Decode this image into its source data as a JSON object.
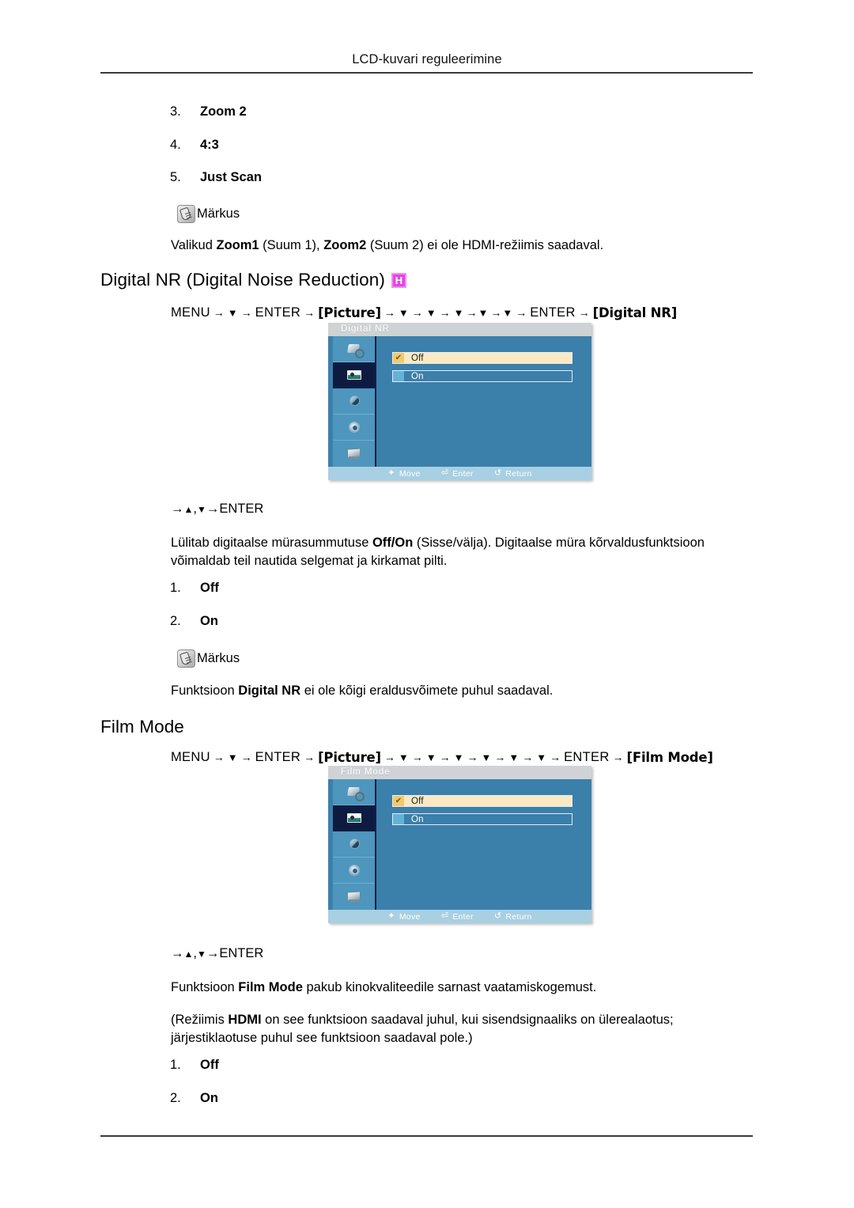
{
  "header": {
    "running_head": "LCD-kuvari reguleerimine"
  },
  "list_top": [
    {
      "num": "3.",
      "text": "Zoom 2"
    },
    {
      "num": "4.",
      "text": "4:3"
    },
    {
      "num": "5.",
      "text": "Just Scan"
    }
  ],
  "note_top": {
    "icon": "note-pen-icon",
    "label": "Märkus",
    "body_prefix": "Valikud ",
    "body_b1": "Zoom1",
    "body_mid1": " (Suum 1), ",
    "body_b2": "Zoom2",
    "body_mid2": " (Suum 2) ei ole HDMI-režiimis saadaval."
  },
  "section_digital_nr": {
    "heading": "Digital NR (Digital Noise Reduction)",
    "badge": "H",
    "badge_color": "#e048e0",
    "menu_path": {
      "start": "MENU",
      "arrow": "→",
      "down": "▼",
      "enter": "ENTER",
      "chip_picture": "[Picture]",
      "chip_target": "[Digital NR]",
      "down_count": 5
    },
    "osd": {
      "title": "Digital  NR",
      "sidebar_icons": [
        "input-icon",
        "picture-icon",
        "sound-icon",
        "setup-icon",
        "multi-control-icon"
      ],
      "selected_sidebar_index": 1,
      "rows": [
        {
          "label": "Off",
          "selected": true,
          "check": "✔"
        },
        {
          "label": "On",
          "selected": false,
          "check": ""
        }
      ],
      "footer": [
        {
          "glyph": "✦",
          "label": "Move",
          "icon": "move-icon"
        },
        {
          "glyph": "⏎",
          "label": "Enter",
          "icon": "enter-icon"
        },
        {
          "glyph": "↺",
          "label": "Return",
          "icon": "return-icon"
        }
      ]
    },
    "enter_line": {
      "arrow": "→",
      "up": "▲",
      "comma": ",",
      "down": "▼",
      "enter": "ENTER"
    },
    "description": "Lülitab digitaalse mürasummutuse Off/On (Sisse/välja). Digitaalse müra kõrvaldusfunktsioon võimaldab teil nautida selgemat ja kirkamat pilti.",
    "description_parts": {
      "p1": "Lülitab digitaalse mürasummutuse ",
      "b1": "Off/On",
      "p2": " (Sisse/välja). Digitaalse müra kõrvaldusfunktsioon võimaldab teil nautida selgemat ja kirkamat pilti."
    },
    "options": [
      {
        "num": "1.",
        "text": "Off"
      },
      {
        "num": "2.",
        "text": "On"
      }
    ],
    "note": {
      "icon": "note-pen-icon",
      "label": "Märkus",
      "body_p1": "Funktsioon ",
      "body_b1": "Digital NR",
      "body_p2": " ei ole kõigi eraldusvõimete puhul saadaval."
    }
  },
  "section_film_mode": {
    "heading": "Film Mode",
    "menu_path": {
      "start": "MENU",
      "arrow": "→",
      "down": "▼",
      "enter": "ENTER",
      "chip_picture": "[Picture]",
      "chip_target": "[Film Mode]",
      "down_count": 6
    },
    "osd": {
      "title": "Film Mode",
      "sidebar_icons": [
        "input-icon",
        "picture-icon",
        "sound-icon",
        "setup-icon",
        "multi-control-icon"
      ],
      "selected_sidebar_index": 1,
      "rows": [
        {
          "label": "Off",
          "selected": true,
          "check": "✔"
        },
        {
          "label": "On",
          "selected": false,
          "check": ""
        }
      ],
      "footer": [
        {
          "glyph": "✦",
          "label": "Move",
          "icon": "move-icon"
        },
        {
          "glyph": "⏎",
          "label": "Enter",
          "icon": "enter-icon"
        },
        {
          "glyph": "↺",
          "label": "Return",
          "icon": "return-icon"
        }
      ]
    },
    "enter_line": {
      "arrow": "→",
      "up": "▲",
      "comma": ",",
      "down": "▼",
      "enter": "ENTER"
    },
    "description_parts": {
      "p1": "Funktsioon ",
      "b1": "Film Mode",
      "p2": " pakub kinokvaliteedile sarnast vaatamiskogemust."
    },
    "hdmi_note_parts": {
      "p1": "(Režiimis ",
      "b1": "HDMI",
      "p2": " on see funktsioon saadaval juhul, kui sisendsignaaliks on ülerealaotus; järjestiklaotuse puhul see funktsioon saadaval pole.)"
    },
    "options": [
      {
        "num": "1.",
        "text": "Off"
      },
      {
        "num": "2.",
        "text": "On"
      }
    ]
  }
}
